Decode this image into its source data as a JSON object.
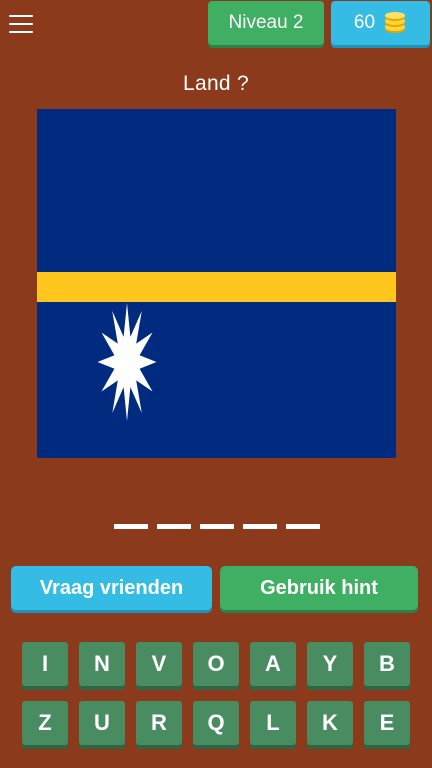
{
  "header": {
    "menu_icon": "hamburger-menu-icon",
    "level_label": "Niveau 2",
    "coins": "60",
    "coins_icon": "coin-stack-icon"
  },
  "question": "Land ?",
  "flag": {
    "description_icon": "nauru-flag",
    "colors": {
      "blue": "#002B7F",
      "yellow": "#FFC61E",
      "star": "#FFFFFF"
    }
  },
  "answer": {
    "slot_count": 5
  },
  "actions": {
    "ask_friends": "Vraag vrienden",
    "use_hint": "Gebruik hint"
  },
  "keyboard": {
    "row1": [
      "I",
      "N",
      "V",
      "O",
      "A",
      "Y",
      "B"
    ],
    "row2": [
      "Z",
      "U",
      "R",
      "Q",
      "L",
      "K",
      "E"
    ]
  },
  "colors": {
    "background": "#8B3A1B",
    "green": "#3EAF63",
    "blue": "#34BCE4",
    "key": "#4A8C62"
  }
}
